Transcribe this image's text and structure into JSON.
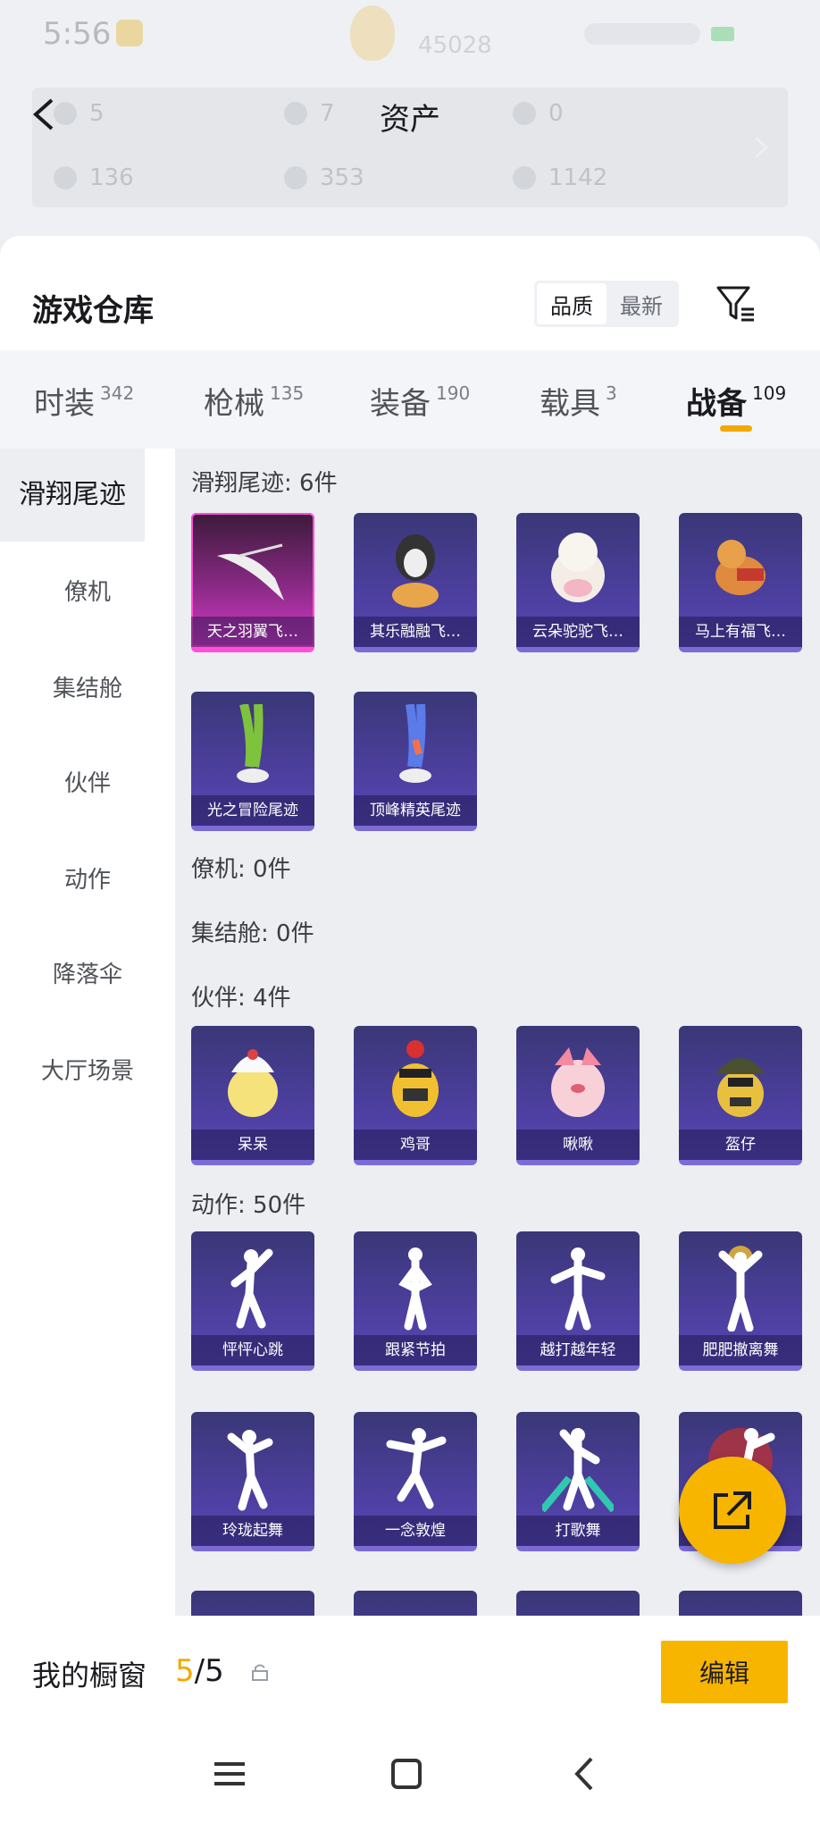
{
  "status_bar": {
    "time": "5:56",
    "center_number": "45028",
    "battery": "5"
  },
  "header": {
    "title": "资产"
  },
  "assets": [
    {
      "value": "5"
    },
    {
      "value": "7"
    },
    {
      "value": "0"
    },
    {
      "value": "136"
    },
    {
      "value": "353"
    },
    {
      "value": "1142"
    }
  ],
  "warehouse": {
    "title": "游戏仓库",
    "sort": {
      "quality": "品质",
      "newest": "最新"
    }
  },
  "tabs": [
    {
      "label": "时装",
      "count": "342"
    },
    {
      "label": "枪械",
      "count": "135"
    },
    {
      "label": "装备",
      "count": "190"
    },
    {
      "label": "载具",
      "count": "3"
    },
    {
      "label": "战备",
      "count": "109"
    }
  ],
  "sidebar": [
    "滑翔尾迹",
    "僚机",
    "集结舱",
    "伙伴",
    "动作",
    "降落伞",
    "大厅场景"
  ],
  "sections": {
    "glide": {
      "title": "滑翔尾迹: 6件",
      "items": [
        "天之羽翼飞…",
        "其乐融融飞…",
        "云朵驼驼飞…",
        "马上有福飞…",
        "光之冒险尾迹",
        "顶峰精英尾迹"
      ]
    },
    "wingman": {
      "title": "僚机: 0件"
    },
    "capsule": {
      "title": "集结舱: 0件"
    },
    "partner": {
      "title": "伙伴: 4件",
      "items": [
        "呆呆",
        "鸡哥",
        "啾啾",
        "盔仔"
      ]
    },
    "emote": {
      "title": "动作: 50件",
      "items": [
        "怦怦心跳",
        "跟紧节拍",
        "越打越年轻",
        "肥肥撤离舞",
        "玲珑起舞",
        "一念敦煌",
        "打歌舞",
        ""
      ]
    }
  },
  "showcase": {
    "label": "我的橱窗",
    "count_current": "5",
    "count_sep": "/",
    "count_total": "5",
    "edit_label": "编辑"
  },
  "colors": {
    "accent": "#f7b500",
    "card_bg": "#4c3f9e",
    "card_highlight": "#d63bc8"
  }
}
